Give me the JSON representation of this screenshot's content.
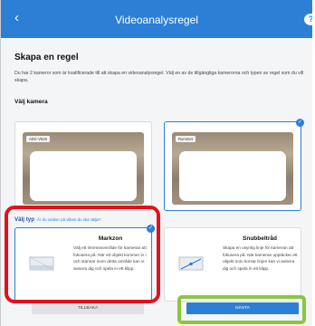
{
  "header": {
    "back_icon": "chevron-left-icon",
    "title": "Videoanalysregel",
    "help_icon": "help-circle-icon",
    "help_glyph": "?"
  },
  "main": {
    "heading": "Skapa en regel",
    "description": "Du har 2 kameror som är kvalificerade till att skapa en videoanalysregel. Välj en av de tillgängliga kamerorna och typen av regel som du vill skapa.",
    "camera_section_label": "Välj kamera",
    "cameras": [
      {
        "label": "ADC-V515",
        "selected": false
      },
      {
        "label": "Rummet",
        "selected": true
      }
    ],
    "type_section_label": "Välj typ",
    "type_hint": "Är du osäker på vilken du ska välja?",
    "rule_types": [
      {
        "name": "Markzon",
        "description": "Välj ett intresseområde för kameran att fokusera på. När ett objekt kommer in i och stannar inom detta område kan vi avisera dig och spela in ett klipp.",
        "selected": true,
        "icon": "area-zone-icon"
      },
      {
        "name": "Snubbeltråd",
        "description": "Skapa en osynlig linje för kameran att fokusera på. När kameran upptäcker ett objekt som korsar linjen kan vi avisera dig och spela in ett klipp.",
        "selected": false,
        "icon": "tripwire-icon"
      }
    ]
  },
  "footer": {
    "back_label": "TILLBAKA",
    "next_label": "NÄSTA"
  },
  "colors": {
    "accent": "#2d7fd6",
    "highlight_red": "#e2121a",
    "highlight_green": "#8cc63f"
  }
}
